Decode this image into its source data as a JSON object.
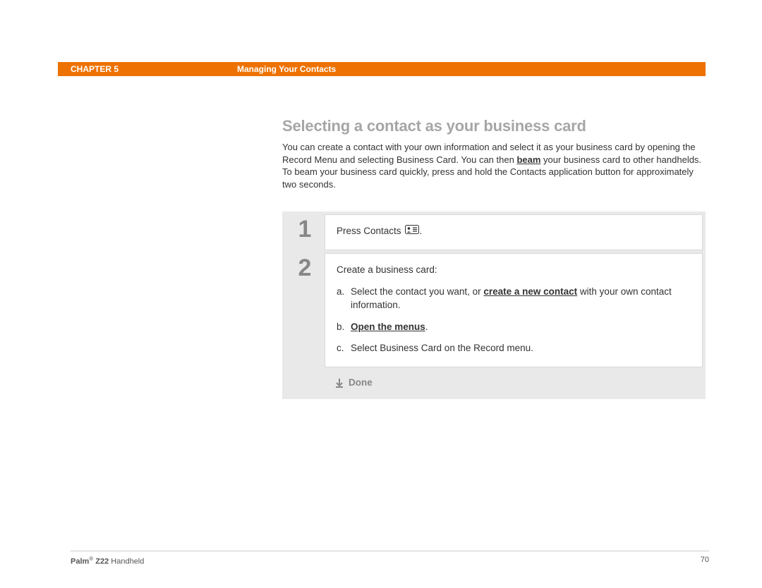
{
  "header": {
    "chapter_label": "CHAPTER 5",
    "title": "Managing Your Contacts"
  },
  "section": {
    "heading": "Selecting a contact as your business card",
    "intro_part1": "You can create a contact with your own information and select it as your business card by opening the Record Menu and selecting Business Card. You can then ",
    "intro_beam": "beam",
    "intro_part2": " your business card to other handhelds. To beam your business card quickly, press and hold the Contacts application button for approximately two seconds."
  },
  "steps": {
    "s1": {
      "num": "1",
      "text": "Press Contacts ",
      "suffix": "."
    },
    "s2": {
      "num": "2",
      "lead": "Create a business card:",
      "a_label": "a.",
      "a_text1": "Select the contact you want, or ",
      "a_link": "create a new contact",
      "a_text2": " with your own contact information.",
      "b_label": "b.",
      "b_text": "Open the menus",
      "b_suffix": ".",
      "c_label": "c.",
      "c_text": "Select Business Card on the Record menu."
    }
  },
  "done": {
    "label": "Done"
  },
  "footer": {
    "brand": "Palm",
    "reg": "®",
    "model": " Z22",
    "tail": " Handheld",
    "page": "70"
  }
}
